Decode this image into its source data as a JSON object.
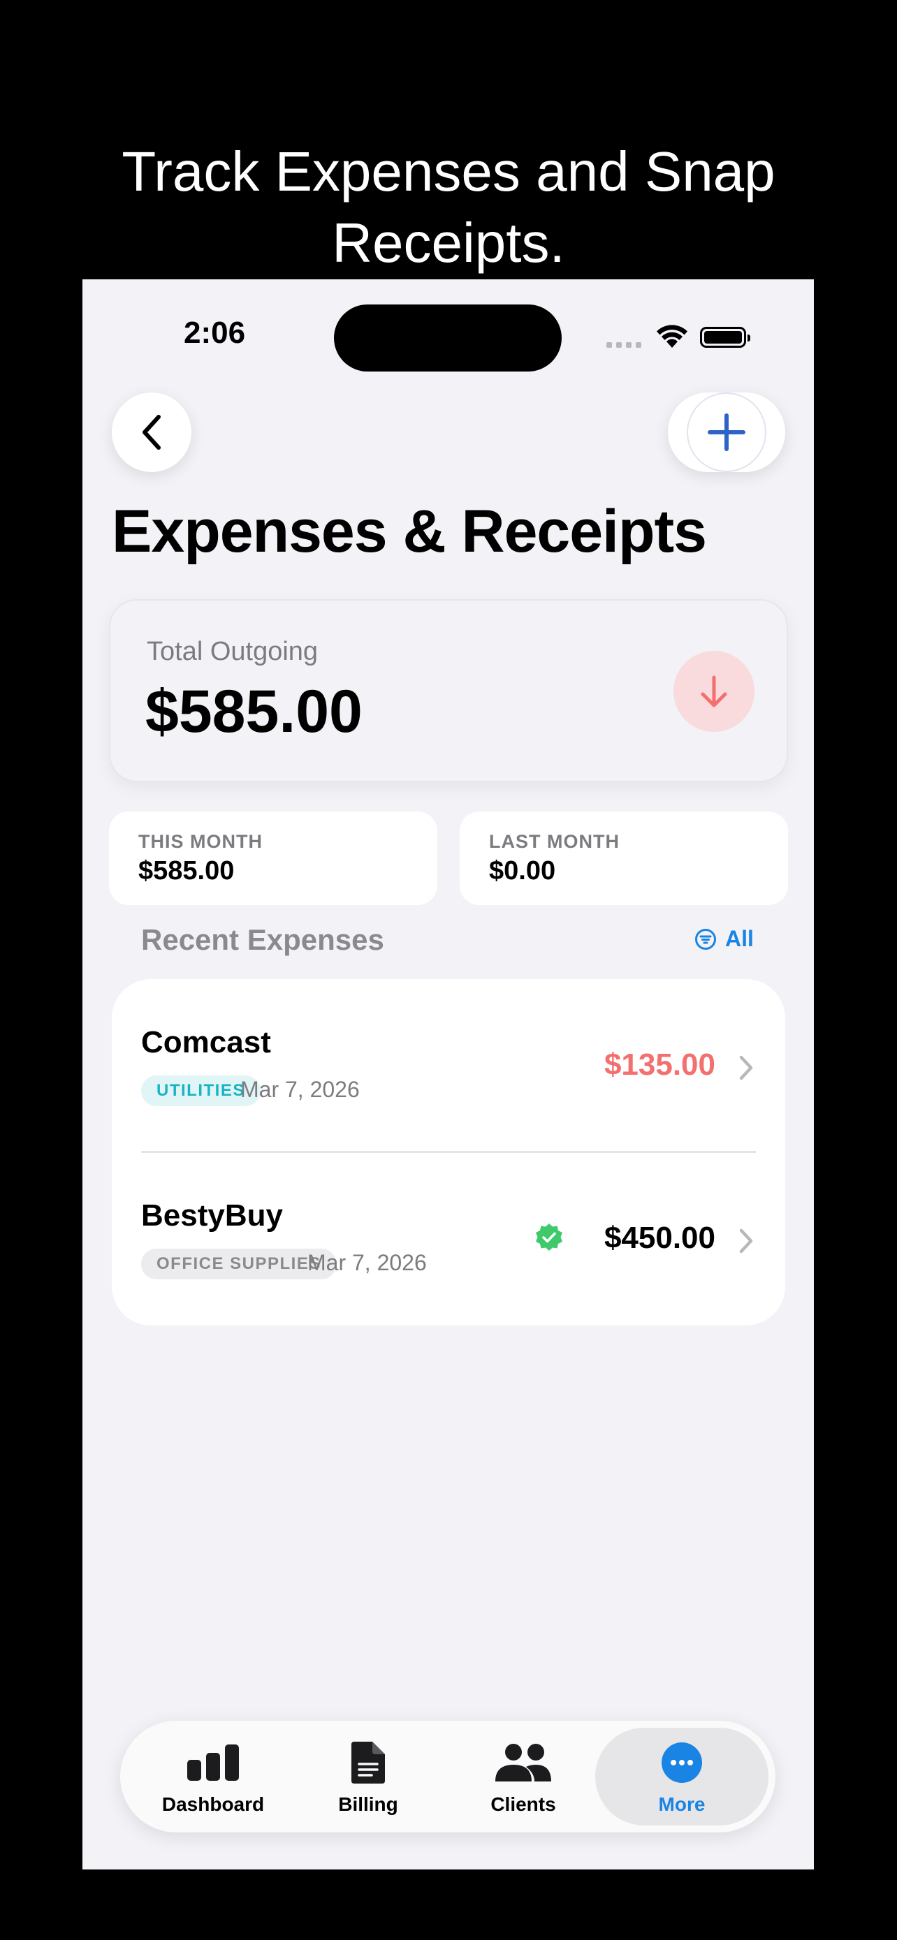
{
  "promo": {
    "line1": "Track Expenses and Snap",
    "line2": "Receipts."
  },
  "status_bar": {
    "time": "2:06"
  },
  "header": {
    "title": "Expenses & Receipts"
  },
  "total": {
    "label": "Total Outgoing",
    "value": "$585.00"
  },
  "months": [
    {
      "label": "THIS MONTH",
      "value": "$585.00"
    },
    {
      "label": "LAST MONTH",
      "value": "$0.00"
    }
  ],
  "recent": {
    "title": "Recent Expenses",
    "all_label": "All"
  },
  "expenses": [
    {
      "vendor": "Comcast",
      "category": "UTILITIES",
      "date": "Mar 7, 2026",
      "amount": "$135.00",
      "amount_color": "#f2706f",
      "verified": false
    },
    {
      "vendor": "BestyBuy",
      "category": "OFFICE SUPPLIES",
      "date": "Mar 7, 2026",
      "amount": "$450.00",
      "amount_color": "#000000",
      "verified": true
    }
  ],
  "tabs": [
    {
      "label": "Dashboard",
      "icon": "bar-chart-icon",
      "active": false
    },
    {
      "label": "Billing",
      "icon": "document-icon",
      "active": false
    },
    {
      "label": "Clients",
      "icon": "people-icon",
      "active": false
    },
    {
      "label": "More",
      "icon": "more-icon",
      "active": true
    }
  ],
  "colors": {
    "accent": "#1a84e4",
    "negative": "#f2706f",
    "verified": "#3fc96a",
    "background": "#f2f2f7"
  }
}
